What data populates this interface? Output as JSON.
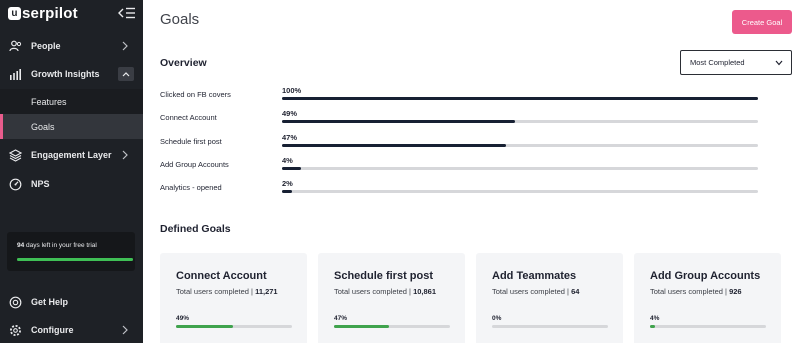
{
  "app": {
    "logo_mark": "u",
    "logo_text": "serpilot"
  },
  "sidebar": {
    "items": [
      {
        "label": "People",
        "icon": "people-icon"
      },
      {
        "label": "Growth Insights",
        "icon": "bar-chart-icon"
      },
      {
        "label": "Engagement Layer",
        "icon": "layers-icon"
      },
      {
        "label": "NPS",
        "icon": "nps-icon"
      },
      {
        "label": "Get Help",
        "icon": "help-icon"
      },
      {
        "label": "Configure",
        "icon": "gear-icon"
      }
    ],
    "sub_items": [
      {
        "label": "Features"
      },
      {
        "label": "Goals"
      }
    ],
    "trial": {
      "days": "94",
      "text": " days left in your free trial",
      "progress": 1.0
    }
  },
  "header": {
    "title": "Goals",
    "create_label": "Create Goal"
  },
  "overview": {
    "title": "Overview",
    "sort_value": "Most Completed",
    "rows": [
      {
        "label": "Clicked on FB covers",
        "pct_label": "100%",
        "value": 100
      },
      {
        "label": "Connect Account",
        "pct_label": "49%",
        "value": 49
      },
      {
        "label": "Schedule first post",
        "pct_label": "47%",
        "value": 47
      },
      {
        "label": "Add Group Accounts",
        "pct_label": "4%",
        "value": 4
      },
      {
        "label": "Analytics - opened",
        "pct_label": "2%",
        "value": 2
      }
    ]
  },
  "defined_goals": {
    "title": "Defined Goals",
    "sub_prefix": "Total users completed | ",
    "cards": [
      {
        "title": "Connect Account",
        "count": "11,271",
        "pct_label": "49%",
        "value": 49
      },
      {
        "title": "Schedule first post",
        "count": "10,861",
        "pct_label": "47%",
        "value": 47
      },
      {
        "title": "Add Teammates",
        "count": "64",
        "pct_label": "0%",
        "value": 0
      },
      {
        "title": "Add Group Accounts",
        "count": "926",
        "pct_label": "4%",
        "value": 4
      }
    ]
  },
  "colors": {
    "sidebar_bg": "#1e2126",
    "accent_pink": "#ec5a8c",
    "progress_dark": "#172033",
    "progress_green": "#3fa34d"
  }
}
